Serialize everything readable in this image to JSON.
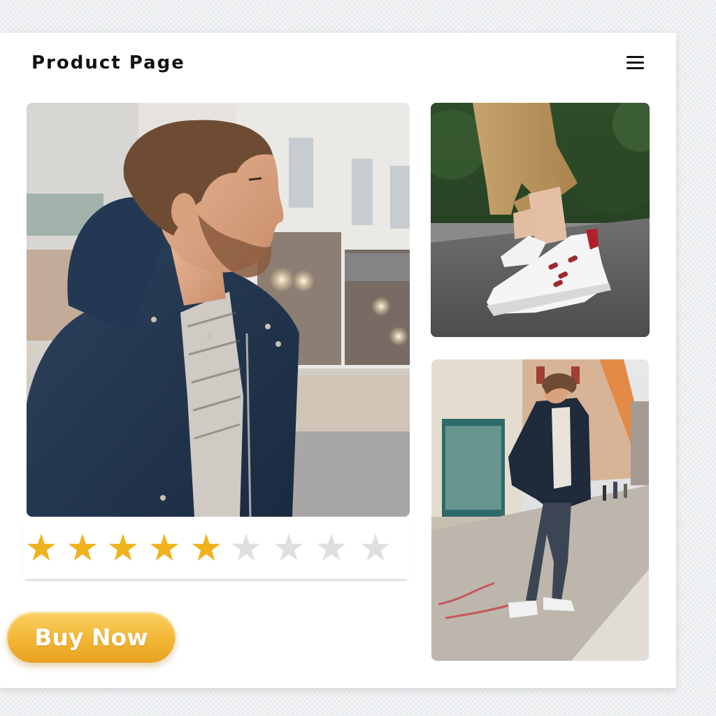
{
  "header": {
    "title": "Product Page",
    "menu_icon": "hamburger-menu-icon"
  },
  "gallery": {
    "main_photo": "man-in-navy-hooded-jacket-photo",
    "shoe_photo": "white-sneaker-closeup-photo",
    "full_photo": "man-full-outfit-street-photo"
  },
  "rating": {
    "value": 5,
    "max": 9,
    "icon": "star-icon",
    "filled_color": "#f0b21d",
    "empty_color": "#dedfe1"
  },
  "actions": {
    "buy_label": "Buy Now",
    "buy_color": "#f2b634"
  }
}
